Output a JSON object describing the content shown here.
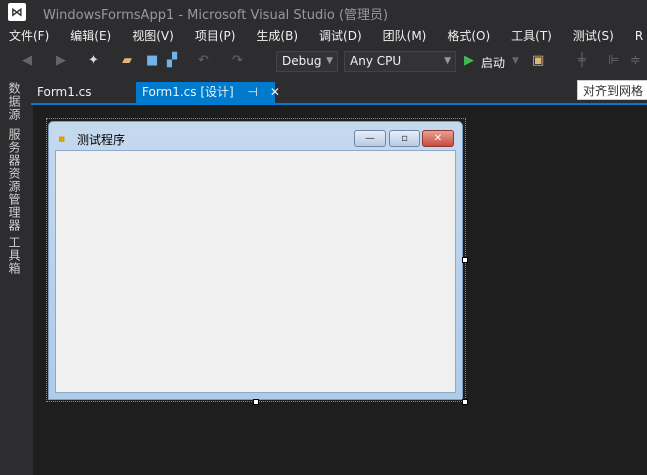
{
  "window": {
    "title": "WindowsFormsApp1 - Microsoft Visual Studio (管理员)",
    "logo": "VS"
  },
  "menu": [
    "文件(F)",
    "编辑(E)",
    "视图(V)",
    "项目(P)",
    "生成(B)",
    "调试(D)",
    "团队(M)",
    "格式(O)",
    "工具(T)",
    "测试(S)",
    "R 工具"
  ],
  "toolbar": {
    "config": "Debug",
    "platform": "Any CPU",
    "start_label": "启动",
    "start_icon": "play-icon"
  },
  "sidebar": [
    "数据源",
    "服务器资源管理器",
    "工具箱"
  ],
  "tabs": [
    {
      "label": "Form1.cs",
      "active": false
    },
    {
      "label": "Form1.cs [设计]",
      "active": true,
      "pin": "⊣",
      "close": "✕"
    }
  ],
  "tooltip": "对齐到网格",
  "form": {
    "title": "测试程序",
    "minimize": "—",
    "maximize": "▫",
    "close": "✕"
  },
  "colors": {
    "accent": "#007acc",
    "background": "#2d2d30",
    "designer": "#1e1e1e",
    "close_button": "#c94c3f"
  }
}
